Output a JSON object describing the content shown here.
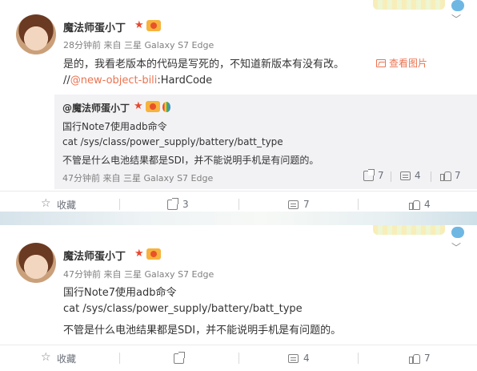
{
  "post1": {
    "username": "魔法师蛋小丁",
    "meta": "28分钟前 来自 三星 Galaxy S7 Edge",
    "text": "是的，我看老版本的代码是写死的，不知道新版本有没有改。",
    "view_image": "查看图片",
    "mention_prefix": "//",
    "mention_link": "@new-object-bili",
    "mention_suffix": ":HardCode",
    "repost": {
      "author": "@魔法师蛋小丁",
      "lines": [
        "国行Note7使用adb命令",
        "cat /sys/class/power_supply/battery/batt_type",
        "不管是什么电池结果都是SDI，并不能说明手机是有问题的。"
      ],
      "meta": "47分钟前 来自 三星 Galaxy S7 Edge",
      "forward_count": "7",
      "comment_count": "4",
      "like_count": "7"
    },
    "actions": {
      "favorite": "收藏",
      "forward": "3",
      "comment": "7",
      "like": "4"
    }
  },
  "post2": {
    "username": "魔法师蛋小丁",
    "meta": "47分钟前 来自 三星 Galaxy S7 Edge",
    "lines": [
      "国行Note7使用adb命令",
      "cat /sys/class/power_supply/battery/batt_type",
      "不管是什么电池结果都是SDI，并不能说明手机是有问题的。"
    ],
    "actions": {
      "favorite": "收藏",
      "forward": "",
      "comment": "4",
      "like": "7"
    }
  },
  "icons": [
    "star-icon",
    "level-icon",
    "balloon-icon",
    "image-icon",
    "favorite-star-icon",
    "forward-icon",
    "comment-icon",
    "like-icon",
    "chevron-down-icon"
  ],
  "colors": {
    "link": "#eb7350",
    "repost_bg": "#f2f2f5",
    "muted": "#808080"
  }
}
